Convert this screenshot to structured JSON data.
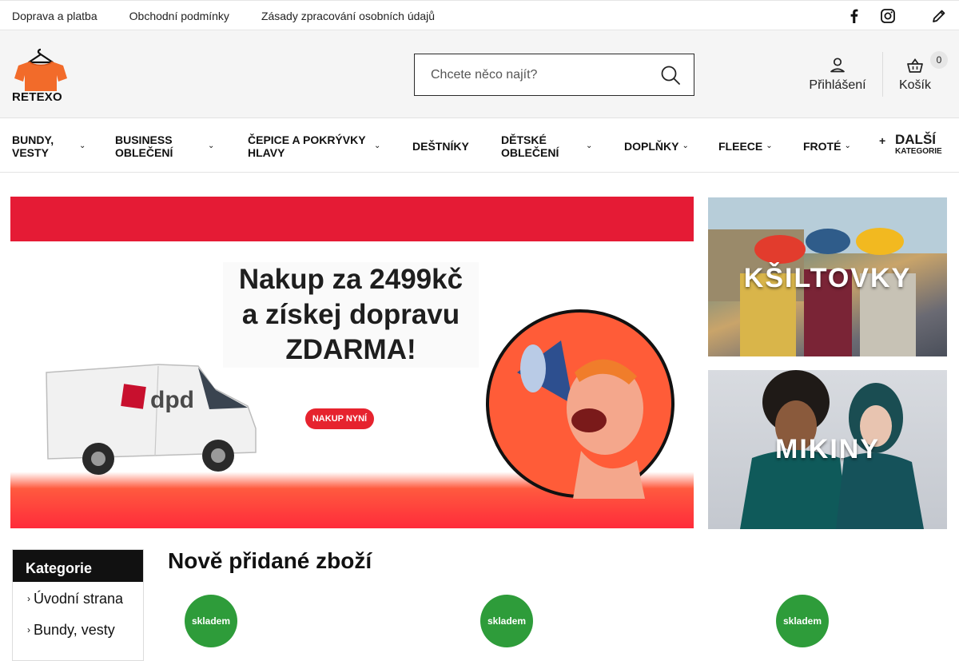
{
  "topbar": {
    "links": [
      "Doprava a platba",
      "Obchodní podmínky",
      "Zásady zpracování osobních údajů"
    ],
    "icons": [
      "facebook-icon",
      "instagram-icon",
      "pencil-icon"
    ]
  },
  "header": {
    "logo_text": "RETEXO",
    "search_placeholder": "Chcete něco najít?",
    "login_label": "Přihlášení",
    "cart_label": "Košík",
    "cart_count": "0",
    "brand_color": "#f26b2a"
  },
  "nav": {
    "items": [
      {
        "label": "Bundy, vesty"
      },
      {
        "label": "Business oblečení"
      },
      {
        "label": "Čepice a pokrývky hlavy"
      },
      {
        "label": "Deštníky"
      },
      {
        "label": "Dětské oblečení"
      },
      {
        "label": "Doplňky"
      },
      {
        "label": "Fleece"
      },
      {
        "label": "Froté"
      }
    ],
    "more_label": "Další",
    "more_sub": "Kategorie"
  },
  "banner": {
    "headline_lines": [
      "Nakup za 2499kč",
      "a získej dopravu",
      "ZDARMA!"
    ],
    "cta": "NAKUP NYNÍ",
    "van_logo": "dpd",
    "colors": {
      "red": "#e51b35",
      "orange": "#ff5a3f"
    }
  },
  "side_banners": [
    {
      "caption": "KŠILTOVKY"
    },
    {
      "caption": "MIKINY"
    }
  ],
  "sidebar": {
    "title": "Kategorie",
    "items": [
      "Úvodní strana",
      "Bundy, vesty"
    ]
  },
  "products": {
    "section_title": "Nově přidané zboží",
    "stock_label": "skladem",
    "stock_color": "#2e9c3a"
  }
}
